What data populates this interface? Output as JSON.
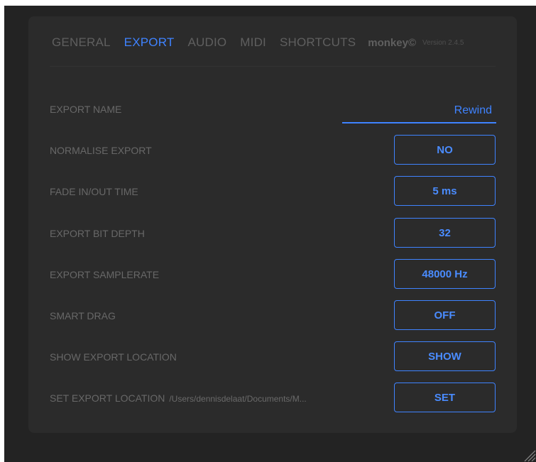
{
  "tabs": [
    {
      "label": "GENERAL",
      "active": false
    },
    {
      "label": "EXPORT",
      "active": true
    },
    {
      "label": "AUDIO",
      "active": false
    },
    {
      "label": "MIDI",
      "active": false
    },
    {
      "label": "SHORTCUTS",
      "active": false
    }
  ],
  "brand": "monkey©",
  "version": "Version 2.4.5",
  "settings": {
    "export_name": {
      "label": "EXPORT NAME",
      "value": "Rewind"
    },
    "normalise_export": {
      "label": "NORMALISE EXPORT",
      "value": "NO"
    },
    "fade_time": {
      "label": "FADE IN/OUT TIME",
      "value": "5 ms"
    },
    "bit_depth": {
      "label": "EXPORT BIT DEPTH",
      "value": "32"
    },
    "samplerate": {
      "label": "EXPORT SAMPLERATE",
      "value": "48000 Hz"
    },
    "smart_drag": {
      "label": "SMART DRAG",
      "value": "OFF"
    },
    "show_location": {
      "label": "SHOW EXPORT LOCATION",
      "value": "SHOW"
    },
    "set_location": {
      "label": "SET EXPORT LOCATION",
      "path": "/Users/dennisdelaat/Documents/M...",
      "value": "SET"
    }
  },
  "colors": {
    "accent": "#3f83ff",
    "background": "#232323",
    "panel": "#2b2b2b",
    "muted_text": "#686868"
  },
  "icons": {
    "resize_handle": "resize-grip-icon"
  }
}
